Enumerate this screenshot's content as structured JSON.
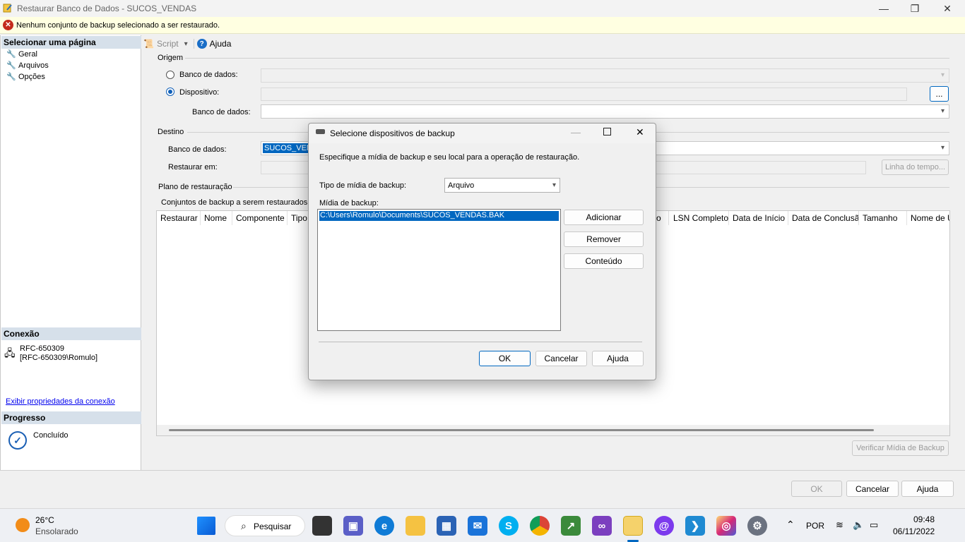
{
  "window": {
    "title": "Restaurar Banco de Dados - SUCOS_VENDAS",
    "minimize": "—",
    "maximize": "❐",
    "close": "✕"
  },
  "error_bar": {
    "message": "Nenhum conjunto de backup selecionado a ser restaurado."
  },
  "left_pane": {
    "select_page_title": "Selecionar uma página",
    "pages": [
      "Geral",
      "Arquivos",
      "Opções"
    ],
    "connection_title": "Conexão",
    "server": "RFC-650309",
    "user": "[RFC-650309\\Romulo]",
    "view_connection_props": "Exibir propriedades da conexão",
    "progress_title": "Progresso",
    "progress_status": "Concluído"
  },
  "toolbar": {
    "script": "Script",
    "help": "Ajuda"
  },
  "origin": {
    "group": "Origem",
    "database_radio": "Banco de dados:",
    "device_radio": "Dispositivo:",
    "browse": "...",
    "database_label": "Banco de dados:"
  },
  "destination": {
    "group": "Destino",
    "database_label": "Banco de dados:",
    "database_value": "SUCOS_VEND",
    "restore_to_label": "Restaurar em:",
    "timeline_button": "Linha do tempo..."
  },
  "plan": {
    "group": "Plano de restauração",
    "sets_label": "Conjuntos de backup a serem restaurados:",
    "columns": [
      "Restaurar",
      "Nome",
      "Componente",
      "Tipo",
      "LSN Completo",
      "Data de Início",
      "Data de Conclusão",
      "Tamanho",
      "Nome de U"
    ],
    "partial_column": "o",
    "verify_button": "Verificar Mídia de Backup"
  },
  "footer": {
    "ok": "OK",
    "cancel": "Cancelar",
    "help": "Ajuda"
  },
  "dialog": {
    "title": "Selecione dispositivos de backup",
    "description": "Especifique a mídia de backup e seu local para a operação de restauração.",
    "media_type_label": "Tipo de mídia de backup:",
    "media_type_value": "Arquivo",
    "media_label": "Mídia de backup:",
    "media_items": [
      "C:\\Users\\Romulo\\Documents\\SUCOS_VENDAS.BAK"
    ],
    "add": "Adicionar",
    "remove": "Remover",
    "contents": "Conteúdo",
    "ok": "OK",
    "cancel": "Cancelar",
    "help": "Ajuda"
  },
  "taskbar": {
    "weather_temp": "26°C",
    "weather_desc": "Ensolarado",
    "search": "Pesquisar",
    "language": "POR",
    "time": "09:48",
    "date": "06/11/2022"
  },
  "colors": {
    "accent": "#0067c0",
    "error": "#c42b1c",
    "info_bar": "#ffffe1",
    "section_header": "#d6e0ea"
  }
}
